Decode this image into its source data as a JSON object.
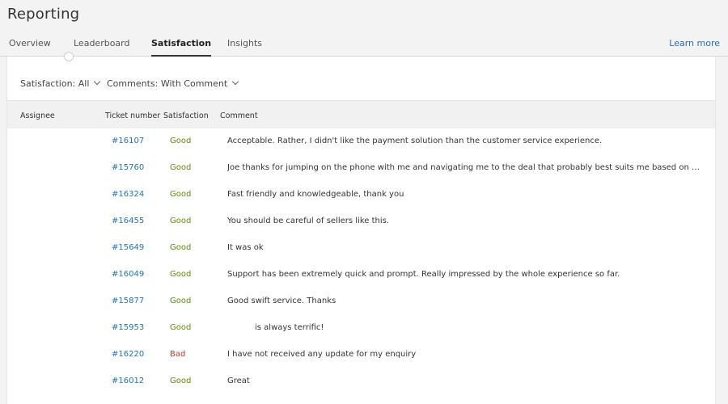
{
  "header": {
    "title": "Reporting",
    "tabs": [
      {
        "label": "Overview",
        "active": false
      },
      {
        "label": "Leaderboard",
        "active": false
      },
      {
        "label": "Satisfaction",
        "active": true
      },
      {
        "label": "Insights",
        "active": false
      }
    ],
    "learn_more": "Learn more"
  },
  "filters": {
    "satisfaction": "Satisfaction: All",
    "comments": "Comments: With Comment"
  },
  "table": {
    "columns": [
      "Assignee",
      "Ticket number",
      "Satisfaction",
      "Comment"
    ],
    "rows": [
      {
        "assignee": "",
        "ticket": "#16107",
        "satisfaction": "Good",
        "comment": "Acceptable. Rather, I didn't like the payment solution than the customer service experience."
      },
      {
        "assignee": "",
        "ticket": "#15760",
        "satisfaction": "Good",
        "comment": "Joe thanks for jumping on the phone with me and navigating me to the deal that probably best suits me based on our c..."
      },
      {
        "assignee": "",
        "ticket": "#16324",
        "satisfaction": "Good",
        "comment": "Fast friendly and knowledgeable, thank you"
      },
      {
        "assignee": "",
        "ticket": "#16455",
        "satisfaction": "Good",
        "comment": "You should be careful of sellers like this."
      },
      {
        "assignee": "",
        "ticket": "#15649",
        "satisfaction": "Good",
        "comment": "It was ok"
      },
      {
        "assignee": "",
        "ticket": "#16049",
        "satisfaction": "Good",
        "comment": "Support has been extremely quick and prompt. Really impressed by the whole experience so far."
      },
      {
        "assignee": "",
        "ticket": "#15877",
        "satisfaction": "Good",
        "comment": "Good swift service. Thanks"
      },
      {
        "assignee": "",
        "ticket": "#15953",
        "satisfaction": "Good",
        "comment": "is always terrific!"
      },
      {
        "assignee": "",
        "ticket": "#16220",
        "satisfaction": "Bad",
        "comment": "I have not received any update for my enquiry"
      },
      {
        "assignee": "",
        "ticket": "#16012",
        "satisfaction": "Good",
        "comment": "Great"
      }
    ]
  },
  "colors": {
    "link": "#1f73b7",
    "good": "#5a8f00",
    "bad": "#c0392b"
  }
}
